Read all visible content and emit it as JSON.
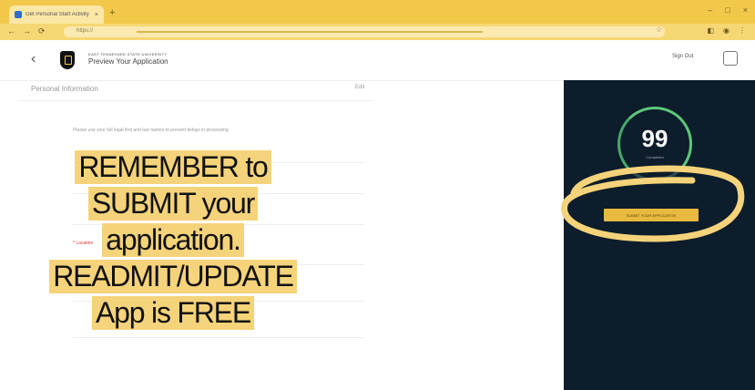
{
  "browser": {
    "tab_title": "Get Personal Start Activity",
    "tab_close": "×",
    "new_tab": "+",
    "window_controls": [
      "–",
      "□",
      "×"
    ],
    "nav": [
      "←",
      "→",
      "⟳"
    ],
    "url": "https://"
  },
  "header": {
    "back": "‹",
    "university": "EAST TENNESSEE STATE UNIVERSITY",
    "page_title": "Preview Your Application",
    "sign_out": "Sign Out"
  },
  "content": {
    "section_title": "Personal Information",
    "edit_link": "Edit",
    "note": "Please use your full legal first and last names to prevent delays in processing",
    "required_marker": "* Location"
  },
  "sidebar": {
    "score": "99",
    "score_label": "Completed",
    "submit_label": "SUBMIT YOUR APPLICATION"
  },
  "callout": [
    "REMEMBER to",
    "SUBMIT your",
    "application.",
    "READMIT/UPDATE",
    "App is FREE"
  ],
  "colors": {
    "accent": "#f5d37a",
    "sidebar_bg": "#0d1d2b",
    "progress": "#5cc87a",
    "button": "#e7b93e"
  }
}
